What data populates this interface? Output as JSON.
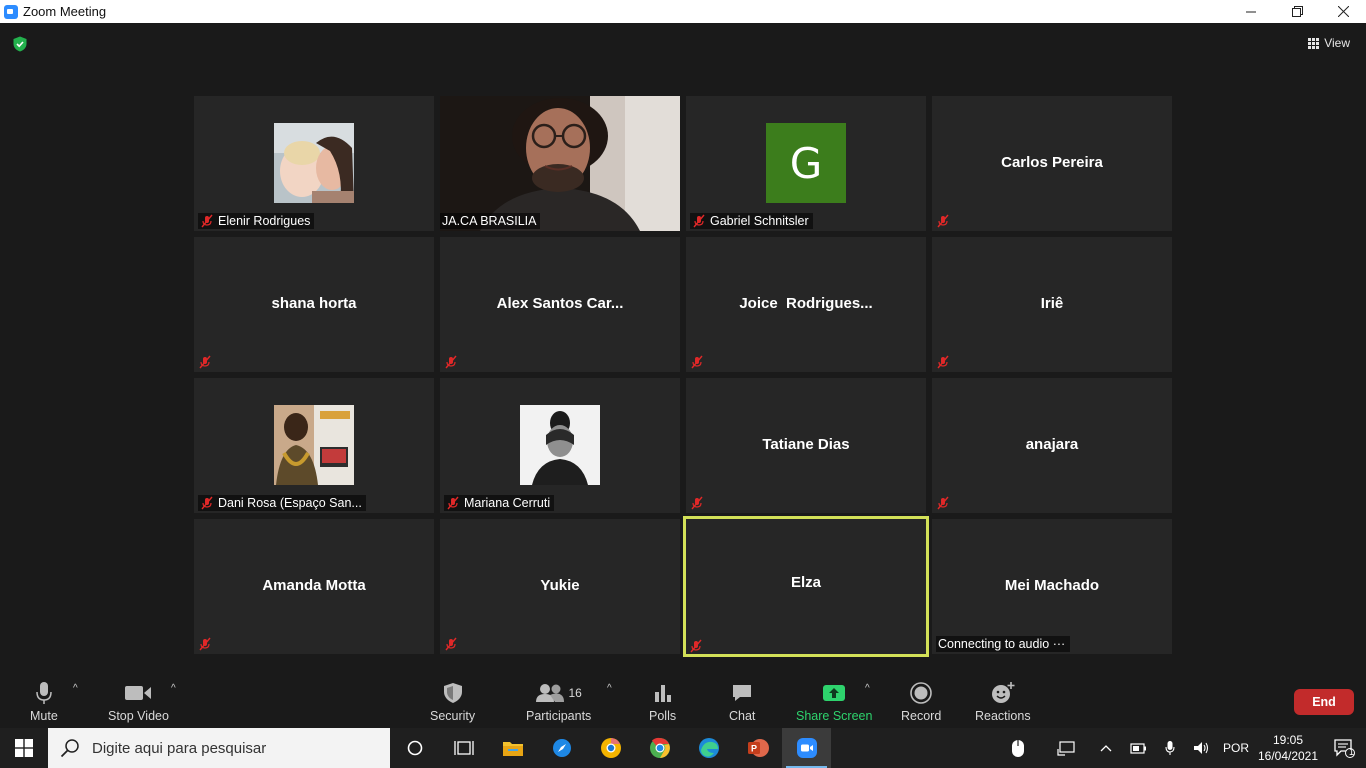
{
  "window": {
    "title": "Zoom Meeting",
    "minimize": "—",
    "restore": "❐",
    "close": "✕"
  },
  "meeting": {
    "view_label": "View",
    "participants": [
      {
        "name": "Elenir Rodrigues",
        "type": "photo",
        "muted": true
      },
      {
        "name": "JA.CA BRASILIA",
        "type": "video",
        "muted": false
      },
      {
        "name": "Gabriel Schnitsler",
        "type": "initial",
        "initial": "G",
        "muted": true
      },
      {
        "name": "Carlos Pereira",
        "type": "name",
        "muted": true
      },
      {
        "name": "shana horta",
        "type": "name",
        "muted": true
      },
      {
        "name": "Alex Santos Car...",
        "type": "name",
        "muted": true
      },
      {
        "name": "Joice  Rodrigues...",
        "type": "name",
        "muted": true
      },
      {
        "name": "Iriê",
        "type": "name",
        "muted": true
      },
      {
        "name": "Dani Rosa (Espaço San...",
        "type": "photo",
        "muted": true
      },
      {
        "name": "Mariana Cerruti",
        "type": "photo",
        "muted": true
      },
      {
        "name": "Tatiane Dias",
        "type": "name",
        "muted": true
      },
      {
        "name": "anajara",
        "type": "name",
        "muted": true
      },
      {
        "name": "Amanda Motta",
        "type": "name",
        "muted": true
      },
      {
        "name": "Yukie",
        "type": "name",
        "muted": true
      },
      {
        "name": "Elza",
        "type": "name",
        "muted": true,
        "active_speaker": true
      },
      {
        "name": "Mei Machado",
        "type": "name",
        "muted": false,
        "status": "Connecting to audio",
        "status_more": "···"
      }
    ],
    "accent_active": "#d3e158"
  },
  "toolbar": {
    "mute": "Mute",
    "stop_video": "Stop Video",
    "security": "Security",
    "participants": "Participants",
    "participants_count": "16",
    "polls": "Polls",
    "chat": "Chat",
    "share_screen": "Share Screen",
    "record": "Record",
    "reactions": "Reactions",
    "end": "End",
    "caret": "^",
    "share_color": "#2ed36d",
    "end_color": "#c22b2b"
  },
  "taskbar": {
    "search_placeholder": "Digite aqui para pesquisar",
    "lang": "POR",
    "time": "19:05",
    "date": "16/04/2021",
    "notification_count": "1"
  }
}
